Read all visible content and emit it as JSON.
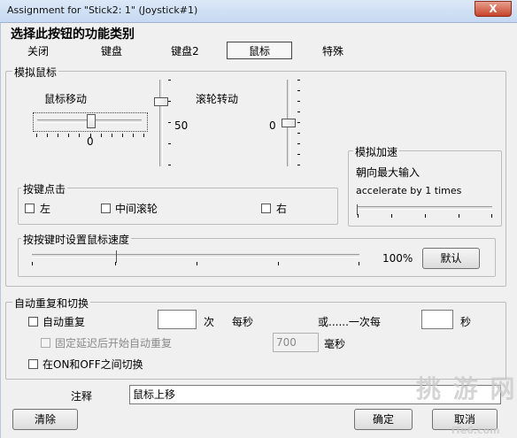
{
  "window": {
    "title": "Assignment for \"Stick2: 1\" (Joystick#1)",
    "close_symbol": "X"
  },
  "header": {
    "label": "选择此按钮的功能类别"
  },
  "tabs": [
    {
      "label": "关闭",
      "active": false
    },
    {
      "label": "键盘",
      "active": false
    },
    {
      "label": "键盘2",
      "active": false
    },
    {
      "label": "鼠标",
      "active": true
    },
    {
      "label": "特殊",
      "active": false
    }
  ],
  "mouse": {
    "group_label": "模拟鼠标",
    "move_label": "鼠标移动",
    "move_value": "0",
    "move_speed_value": "50",
    "wheel_label": "滚轮转动",
    "wheel_value": "0"
  },
  "accel": {
    "group_label": "模拟加速",
    "option_label": "朝向最大输入",
    "accel_label": "accelerate by 1 times"
  },
  "click": {
    "group_label": "按键点击",
    "left_label": "左",
    "middle_label": "中间滚轮",
    "right_label": "右"
  },
  "speed": {
    "group_label": "按按键时设置鼠标速度",
    "value_label": "100%",
    "default_button": "默认"
  },
  "repeat": {
    "group_label": "自动重复和切换",
    "auto_repeat_label": "自动重复",
    "times_value": "",
    "times_unit": "次",
    "per_second": "每秒",
    "or_once_every": "或......一次每",
    "seconds_value": "",
    "seconds_unit": "秒",
    "delay_label": "固定延迟后开始自动重复",
    "delay_value": "700",
    "delay_unit": "毫秒",
    "toggle_label": "在ON和OFF之间切换"
  },
  "footer": {
    "comment_label": "注释",
    "comment_value": "鼠标上移",
    "clear_button": "清除",
    "ok_button": "确定",
    "cancel_button": "取消"
  },
  "watermark": {
    "text": "挑 游 网",
    "site": "iTe6.com"
  },
  "colors": {
    "titlebar": "#c6d9f1",
    "dialog_bg": "#f0f0f0",
    "close_button": "#c7432a"
  }
}
